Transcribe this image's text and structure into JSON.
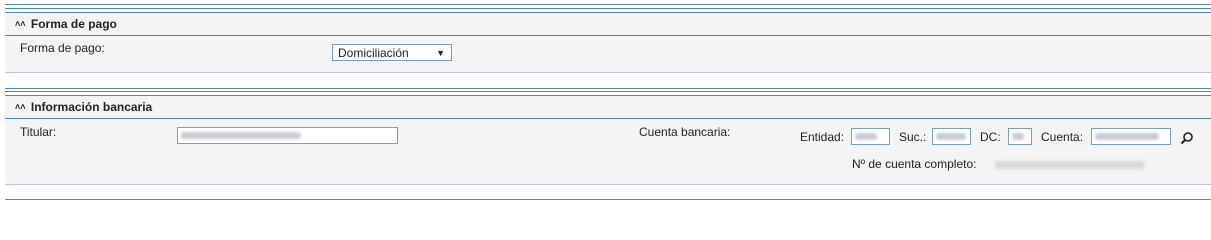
{
  "payment_section": {
    "title": "Forma de pago",
    "field_label": "Forma de pago:",
    "selected_value": "Domiciliación"
  },
  "bank_section": {
    "title": "Información bancaria",
    "titular_label": "Titular:",
    "cuenta_bancaria_label": "Cuenta bancaria:",
    "entidad_label": "Entidad:",
    "suc_label": "Suc.:",
    "dc_label": "DC:",
    "cuenta_label": "Cuenta:",
    "full_account_label": "Nº de cuenta completo:"
  },
  "icons": {
    "collapse": "double-chevron-up-icon",
    "search": "search-icon"
  },
  "colors": {
    "accent": "#4a86c5",
    "panel_bg": "#f4f4f4"
  }
}
